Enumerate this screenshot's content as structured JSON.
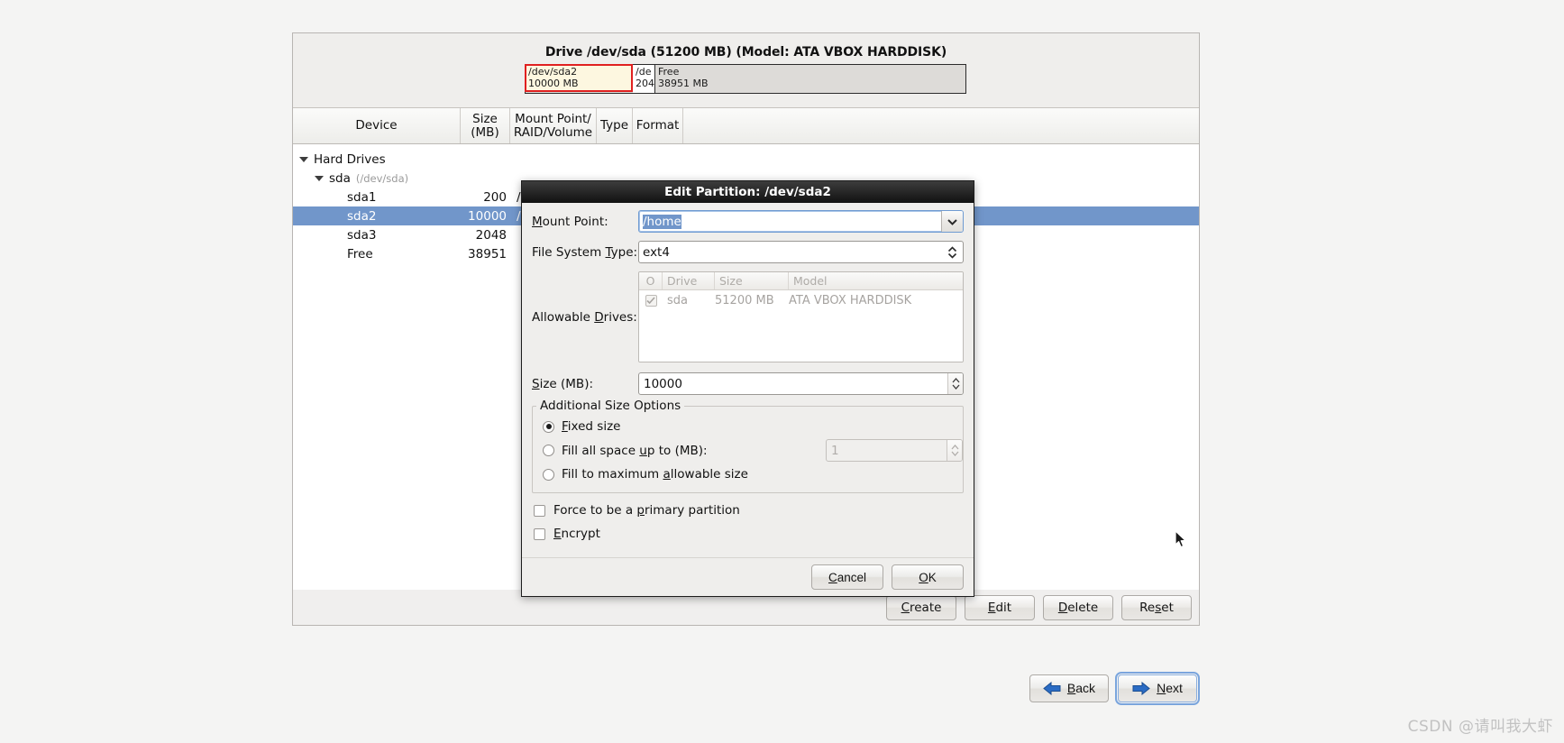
{
  "drive_graphic": {
    "title": "Drive /dev/sda (51200 MB) (Model: ATA VBOX HARDDISK)",
    "segments": [
      {
        "name": "/dev/sda2",
        "size": "10000 MB",
        "state": "selected"
      },
      {
        "name": "/de",
        "size": "204",
        "state": "normal"
      },
      {
        "name": "Free",
        "size": "38951 MB",
        "state": "free"
      }
    ]
  },
  "tree": {
    "headers": {
      "device": "Device",
      "size": "Size\n(MB)",
      "size_line1": "Size",
      "size_line2": "(MB)",
      "mount_line1": "Mount Point/",
      "mount_line2": "RAID/Volume",
      "type": "Type",
      "format": "Format"
    },
    "rows": [
      {
        "label": "Hard Drives",
        "detail": "",
        "size": "",
        "mount": "",
        "indent": 1,
        "expander": true,
        "selected": false
      },
      {
        "label": "sda",
        "detail": "(/dev/sda)",
        "size": "",
        "mount": "",
        "indent": 2,
        "expander": true,
        "selected": false
      },
      {
        "label": "sda1",
        "detail": "",
        "size": "200",
        "mount": "/boot",
        "indent": 3,
        "expander": false,
        "selected": false
      },
      {
        "label": "sda2",
        "detail": "",
        "size": "10000",
        "mount": "/home",
        "indent": 3,
        "expander": false,
        "selected": true
      },
      {
        "label": "sda3",
        "detail": "",
        "size": "2048",
        "mount": "",
        "indent": 3,
        "expander": false,
        "selected": false
      },
      {
        "label": "Free",
        "detail": "",
        "size": "38951",
        "mount": "",
        "indent": 3,
        "expander": false,
        "selected": false
      }
    ]
  },
  "actions": {
    "create": "Create",
    "edit": "Edit",
    "delete": "Delete",
    "reset": "Reset"
  },
  "wizard": {
    "back": "Back",
    "next": "Next"
  },
  "dialog": {
    "title": "Edit Partition: /dev/sda2",
    "mount_point_label": "Mount Point:",
    "mount_point_value": "/home",
    "fs_type_label": "File System Type:",
    "fs_type_value": "ext4",
    "allowable_drives_label": "Allowable Drives:",
    "drives_headers": {
      "check": "O",
      "drive": "Drive",
      "size": "Size",
      "model": "Model"
    },
    "drives_rows": [
      {
        "checked": true,
        "drive": "sda",
        "size": "51200 MB",
        "model": "ATA VBOX HARDDISK"
      }
    ],
    "size_label": "Size (MB):",
    "size_value": "10000",
    "group_legend": "Additional Size Options",
    "radio_fixed": "Fixed size",
    "radio_fill_upto": "Fill all space up to (MB):",
    "fill_upto_value": "1",
    "radio_fill_max": "Fill to maximum allowable size",
    "chk_force_primary": "Force to be a primary partition",
    "chk_encrypt": "Encrypt",
    "cancel": "Cancel",
    "ok": "OK"
  },
  "watermark": "CSDN @请叫我大虾",
  "colors": {
    "selection_blue": "#7196ca",
    "selected_partition_border": "#e02020",
    "selected_partition_fill": "#fdf7e0",
    "free_fill": "#dddbd8",
    "nav_arrow_blue": "#2b6cc4"
  }
}
